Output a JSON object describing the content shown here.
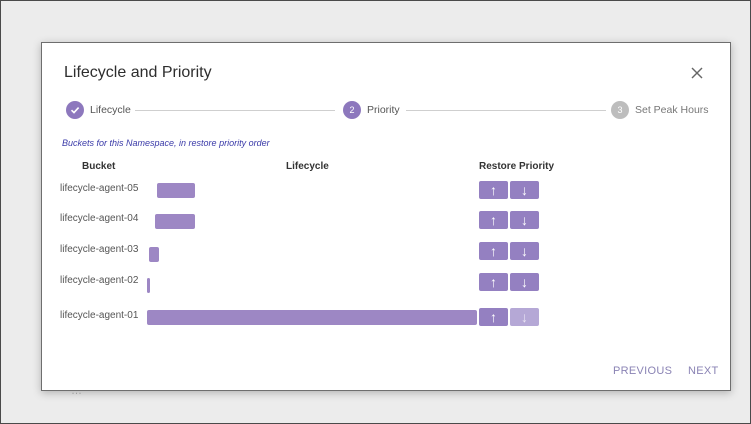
{
  "background": {
    "partial_text": "…"
  },
  "dialog": {
    "title": "Lifecycle and Priority",
    "close_icon": "close-icon",
    "steps": [
      {
        "number": "1",
        "label": "Lifecycle",
        "state": "done"
      },
      {
        "number": "2",
        "label": "Priority",
        "state": "active"
      },
      {
        "number": "3",
        "label": "Set Peak Hours",
        "state": "todo"
      }
    ],
    "subtitle": "Buckets for this Namespace, in restore priority order",
    "columns": {
      "bucket": "Bucket",
      "lifecycle": "Lifecycle",
      "priority": "Restore Priority"
    },
    "buckets": [
      {
        "name": "lifecycle-agent-05",
        "up_enabled": true,
        "down_enabled": true
      },
      {
        "name": "lifecycle-agent-04",
        "up_enabled": true,
        "down_enabled": true
      },
      {
        "name": "lifecycle-agent-03",
        "up_enabled": true,
        "down_enabled": true
      },
      {
        "name": "lifecycle-agent-02",
        "up_enabled": true,
        "down_enabled": true
      },
      {
        "name": "lifecycle-agent-01",
        "up_enabled": true,
        "down_enabled": false
      }
    ],
    "footer": {
      "previous": "PREVIOUS",
      "next": "NEXT"
    }
  },
  "colors": {
    "accent": "#8d78bd",
    "bar": "#9d87c4",
    "link": "#3a3aa8",
    "footer": "#8a83b4"
  }
}
